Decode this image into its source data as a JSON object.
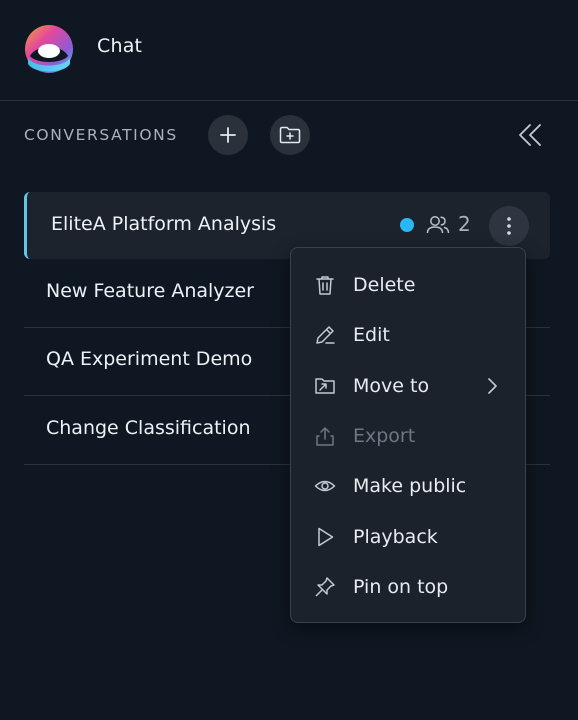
{
  "app": {
    "title": "Chat",
    "logo_icon": "elitea-logo-icon"
  },
  "toolbar": {
    "section_label": "CONVERSATIONS",
    "add_icon": "plus-icon",
    "new_folder_icon": "folder-plus-icon",
    "collapse_icon": "double-chevron-left-icon"
  },
  "conversations": [
    {
      "title": "EliteA Platform Analysis",
      "active": true,
      "status_color": "#29b8f5",
      "participants": "2"
    },
    {
      "title": "New Feature Analyzer"
    },
    {
      "title": "QA Experiment Demo"
    },
    {
      "title": "Change Classification"
    }
  ],
  "menu": {
    "items": [
      {
        "label": "Delete",
        "icon": "trash-icon",
        "enabled": true
      },
      {
        "label": "Edit",
        "icon": "pencil-icon",
        "enabled": true
      },
      {
        "label": "Move to",
        "icon": "folder-move-icon",
        "enabled": true,
        "submenu": true
      },
      {
        "label": "Export",
        "icon": "export-icon",
        "enabled": false
      },
      {
        "label": "Make public",
        "icon": "eye-icon",
        "enabled": true
      },
      {
        "label": "Playback",
        "icon": "play-icon",
        "enabled": true
      },
      {
        "label": "Pin on top",
        "icon": "pin-icon",
        "enabled": true
      }
    ]
  },
  "colors": {
    "background": "#0f1722",
    "active_accent": "#5ec8e6",
    "status_dot": "#29b8f5",
    "menu_background": "#1c222b"
  }
}
